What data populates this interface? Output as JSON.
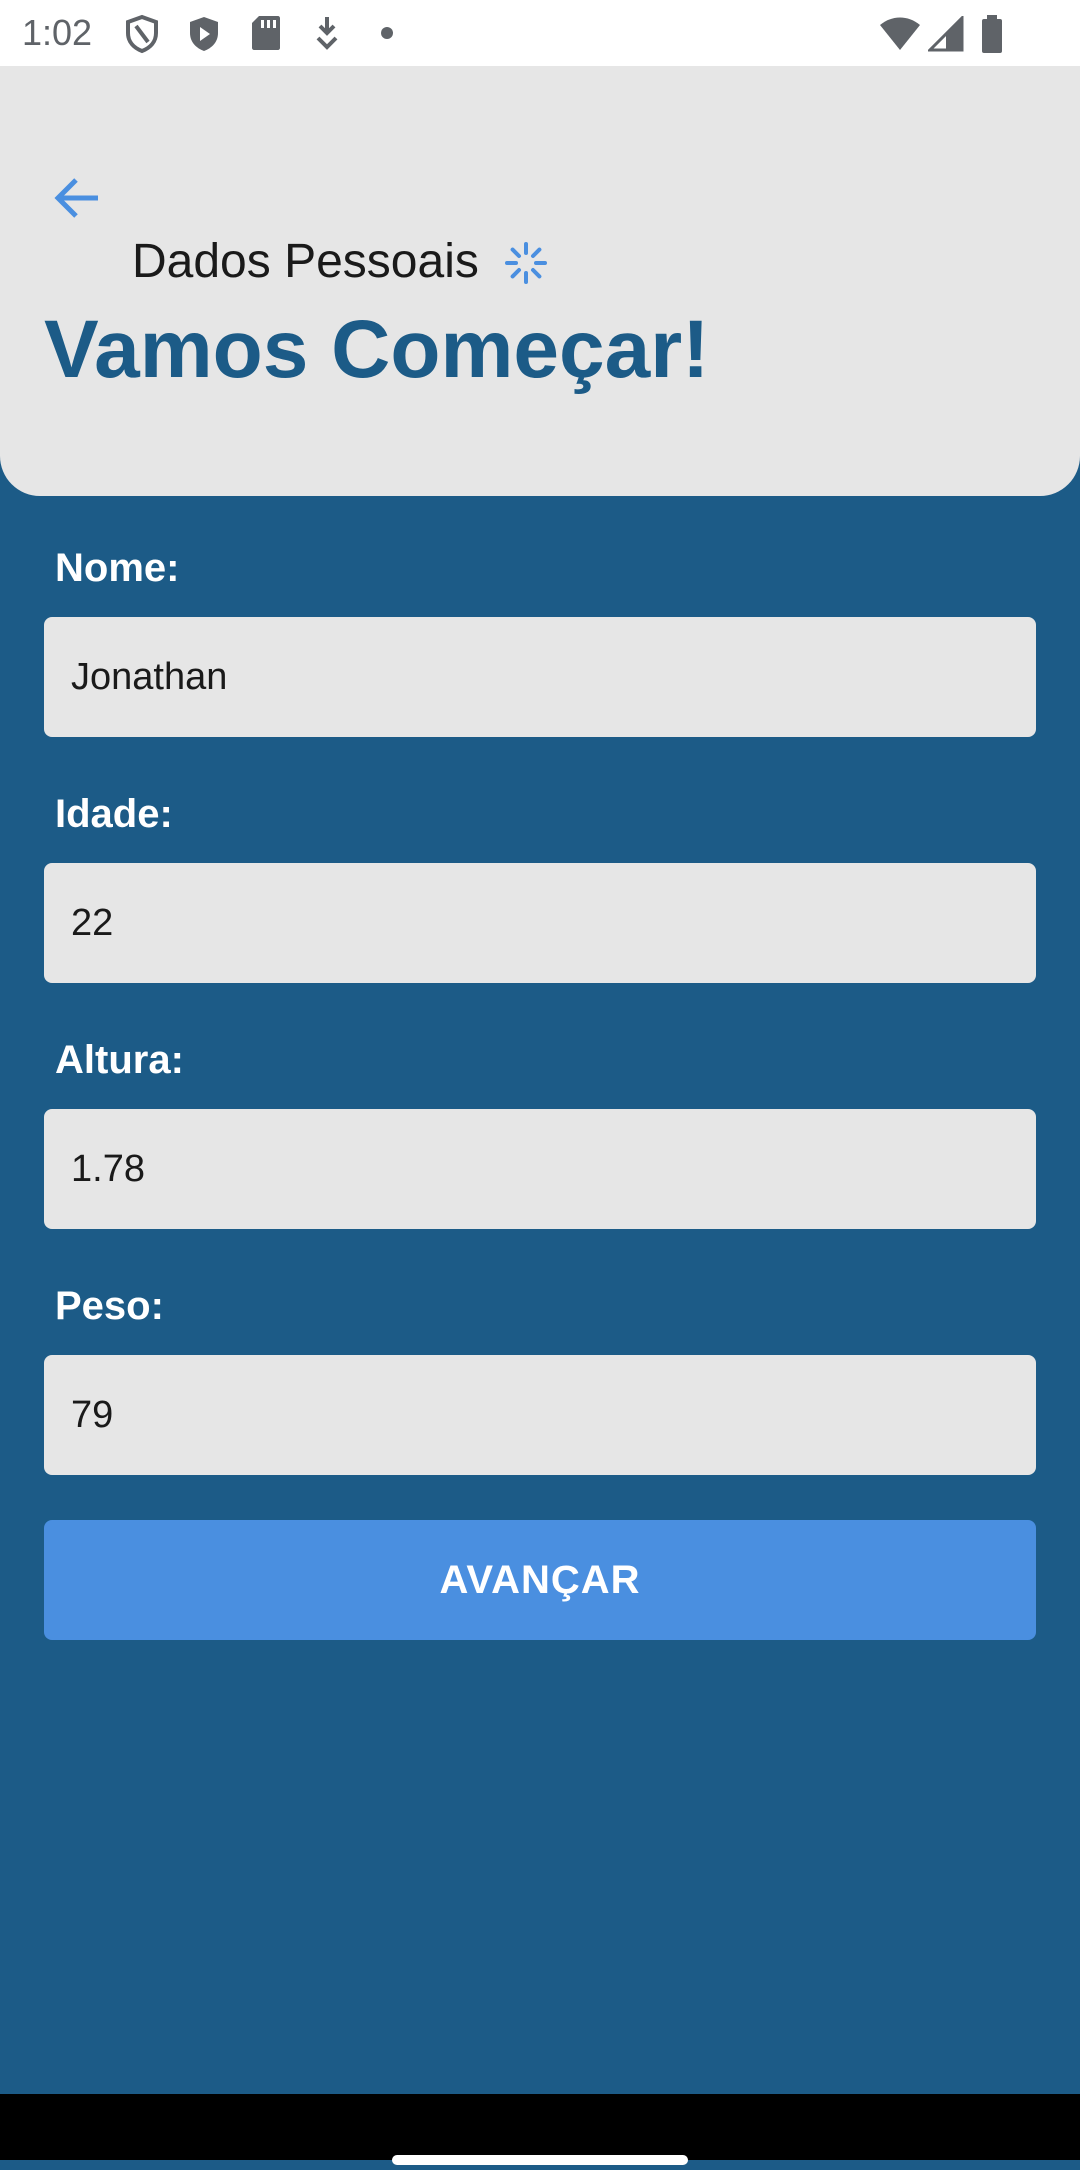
{
  "status_bar": {
    "time": "1:02",
    "icons_left": [
      "shield-outline-icon",
      "shield-play-icon",
      "sd-card-icon",
      "download-icon",
      "dot-icon"
    ],
    "icons_right": [
      "wifi-icon",
      "signal-icon",
      "battery-icon"
    ]
  },
  "header": {
    "screen_title": "Dados Pessoais",
    "headline": "Vamos Começar!",
    "colors": {
      "background": "#e6e6e6",
      "headline": "#1c5b87",
      "back_arrow": "#4a8fe0"
    }
  },
  "form": {
    "fields": [
      {
        "label": "Nome:",
        "value": "Jonathan"
      },
      {
        "label": "Idade:",
        "value": "22"
      },
      {
        "label": "Altura:",
        "value": "1.78"
      },
      {
        "label": "Peso:",
        "value": "79"
      }
    ],
    "submit_label": "AVANÇAR",
    "colors": {
      "background": "#1c5b87",
      "input_background": "#e6e6e6",
      "button": "#4a8fe0"
    }
  }
}
